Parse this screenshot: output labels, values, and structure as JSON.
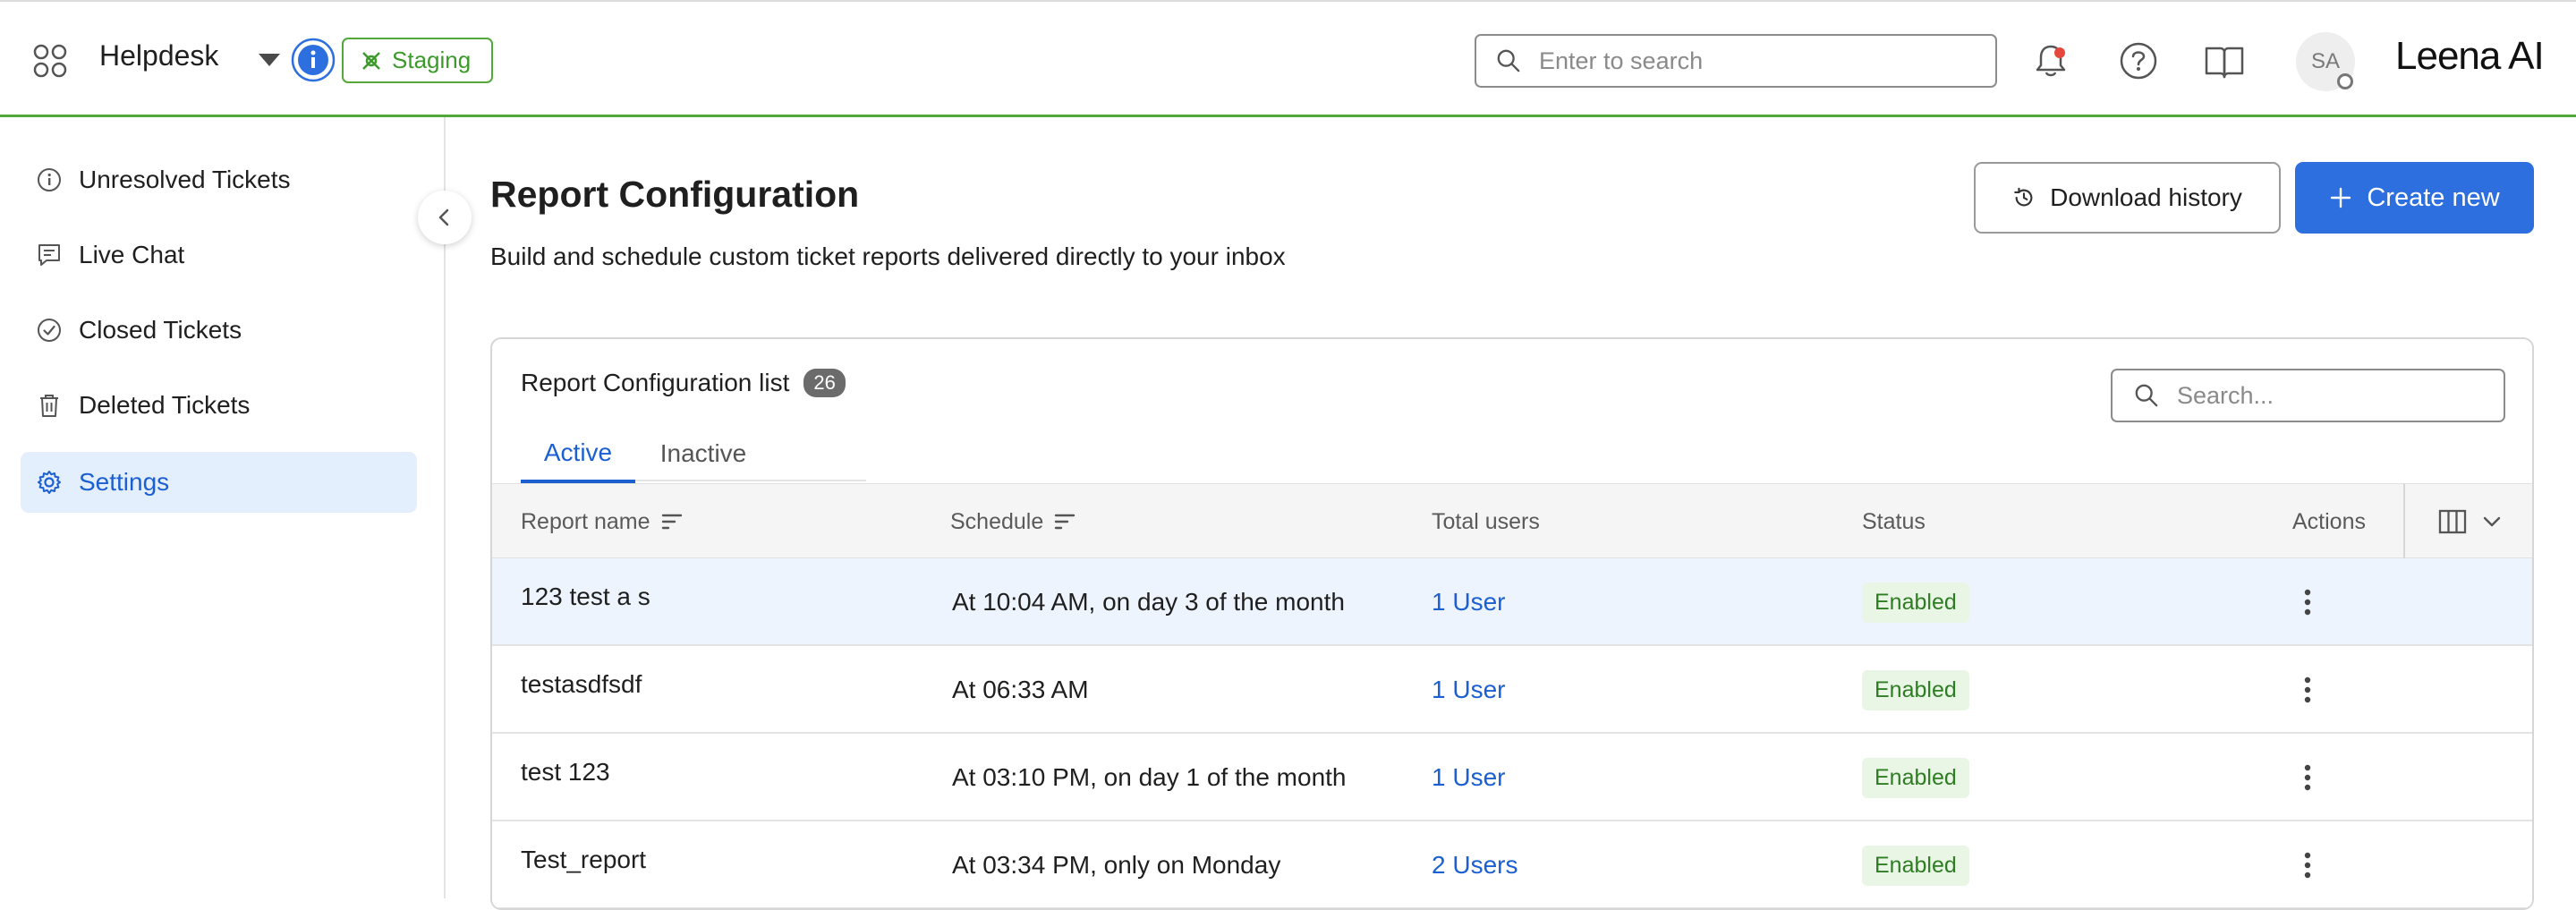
{
  "header": {
    "app_name": "Helpdesk",
    "environment": "Staging",
    "search_placeholder": "Enter to search",
    "avatar_initials": "SA",
    "brand": "Leena AI"
  },
  "sidebar": {
    "items": [
      {
        "label": "Unresolved Tickets",
        "icon": "info-circle-icon"
      },
      {
        "label": "Live Chat",
        "icon": "chat-icon"
      },
      {
        "label": "Closed Tickets",
        "icon": "check-circle-icon"
      },
      {
        "label": "Deleted Tickets",
        "icon": "trash-icon"
      },
      {
        "label": "Settings",
        "icon": "gear-icon",
        "active": true
      }
    ]
  },
  "page": {
    "title": "Report Configuration",
    "subtitle": "Build and schedule custom ticket reports delivered directly to your inbox",
    "download_history_label": "Download history",
    "create_new_label": "Create new"
  },
  "list": {
    "title": "Report Configuration list",
    "count": "26",
    "search_placeholder": "Search...",
    "tabs": [
      {
        "label": "Active",
        "active": true
      },
      {
        "label": "Inactive",
        "active": false
      }
    ],
    "columns": {
      "report_name": "Report name",
      "schedule": "Schedule",
      "total_users": "Total users",
      "status": "Status",
      "actions": "Actions"
    },
    "rows": [
      {
        "name": "123 test a s",
        "schedule": "At 10:04 AM, on day 3 of the month",
        "users": "1 User",
        "status": "Enabled"
      },
      {
        "name": "testasdfsdf",
        "schedule": "At 06:33 AM",
        "users": "1 User",
        "status": "Enabled"
      },
      {
        "name": "test 123",
        "schedule": "At 03:10 PM, on day 1 of the month",
        "users": "1 User",
        "status": "Enabled"
      },
      {
        "name": "Test_report",
        "schedule": "At 03:34 PM, only on Monday",
        "users": "2 Users",
        "status": "Enabled"
      }
    ]
  },
  "colors": {
    "accent": "#2e6fe0",
    "link": "#1c5fd1",
    "staging_green": "#52a83a",
    "enabled_bg": "#e9f6e6",
    "enabled_text": "#2e7d23",
    "selected_nav_bg": "#e4effd"
  }
}
